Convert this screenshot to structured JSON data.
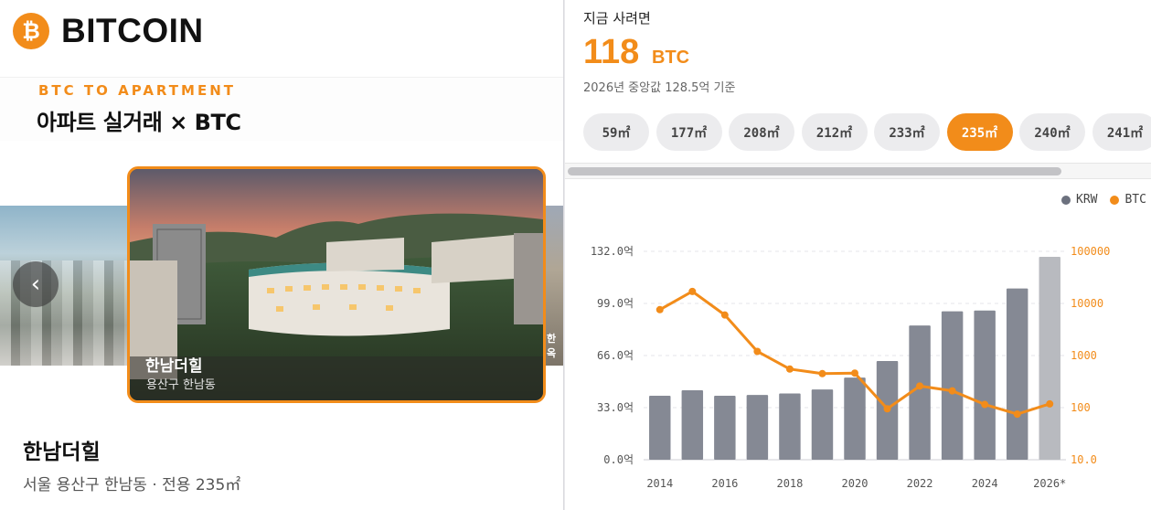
{
  "brand": {
    "logo_glyph": "₿",
    "title": "BITCOIN"
  },
  "left": {
    "eyebrow": "BTC TO APARTMENT",
    "headline": "아파트 실거래 × BTC",
    "carousel": {
      "card_title": "한남더힐",
      "card_location": "용산구  한남동",
      "prev_glyph": "‹",
      "next_card_peek": "한옥"
    },
    "apartment": {
      "name": "한남더힐",
      "meta": "서울  용산구  한남동  ·  전용  235㎡"
    }
  },
  "right": {
    "buy_label": "지금  사려면",
    "btc_value": "118",
    "btc_unit": "BTC",
    "median_note": "2026년  중앙값  128.5억  기준",
    "chips": [
      "59㎡",
      "177㎡",
      "208㎡",
      "212㎡",
      "233㎡",
      "235㎡",
      "240㎡",
      "241㎡"
    ],
    "active_chip": "235㎡"
  },
  "colors": {
    "accent": "#f28c1a",
    "krw_bar": "#858994",
    "krw_bar_estimate": "#b8babf"
  },
  "chart_data": {
    "type": "bar",
    "legend": [
      "KRW",
      "BTC"
    ],
    "legend_position": "top-right",
    "x": [
      2014,
      2015,
      2016,
      2017,
      2018,
      2019,
      2020,
      2021,
      2022,
      2023,
      2024,
      2025,
      2026
    ],
    "x_tick_labels": [
      "2014",
      "2016",
      "2018",
      "2020",
      "2022",
      "2024",
      "2026*"
    ],
    "series": [
      {
        "name": "KRW",
        "kind": "bar",
        "axis": "left",
        "unit": "억",
        "values": [
          40.5,
          44,
          40.5,
          41,
          42,
          44.5,
          52,
          62.5,
          85,
          94,
          94.5,
          108.5,
          128.5
        ]
      },
      {
        "name": "BTC",
        "kind": "line",
        "axis": "right",
        "scale": "log",
        "values": [
          7600,
          17000,
          6000,
          1200,
          550,
          450,
          460,
          95,
          260,
          210,
          115,
          75,
          118
        ]
      }
    ],
    "y_left": {
      "ticks": [
        "0.0억",
        "33.0억",
        "66.0억",
        "99.0억",
        "132.0억"
      ],
      "range": [
        0,
        132
      ]
    },
    "y_right": {
      "ticks": [
        "10.0",
        "100",
        "1000",
        "10000",
        "100000"
      ],
      "range": [
        10,
        100000
      ],
      "log": true
    },
    "grid": true,
    "estimate_note": "2026*"
  }
}
